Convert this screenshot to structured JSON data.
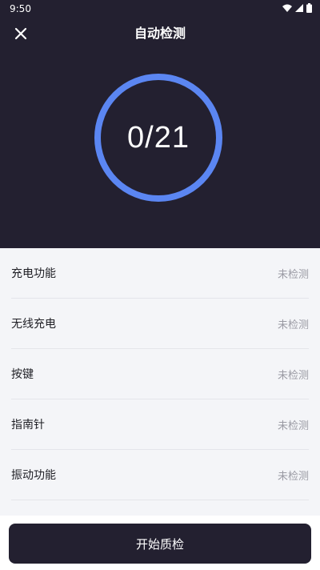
{
  "status_bar": {
    "time": "9:50"
  },
  "header": {
    "title": "自动检测"
  },
  "progress": {
    "label": "0/21",
    "done": 0,
    "total": 21
  },
  "items": [
    {
      "label": "充电功能",
      "status": "未检测"
    },
    {
      "label": "无线充电",
      "status": "未检测"
    },
    {
      "label": "按键",
      "status": "未检测"
    },
    {
      "label": "指南针",
      "status": "未检测"
    },
    {
      "label": "振动功能",
      "status": "未检测"
    },
    {
      "label": "",
      "status": ""
    }
  ],
  "footer": {
    "start_label": "开始质检"
  },
  "colors": {
    "dark_bg": "#232030",
    "ring": "#5b86f2",
    "list_bg": "#f4f5f8",
    "muted": "#9a9aa3"
  }
}
